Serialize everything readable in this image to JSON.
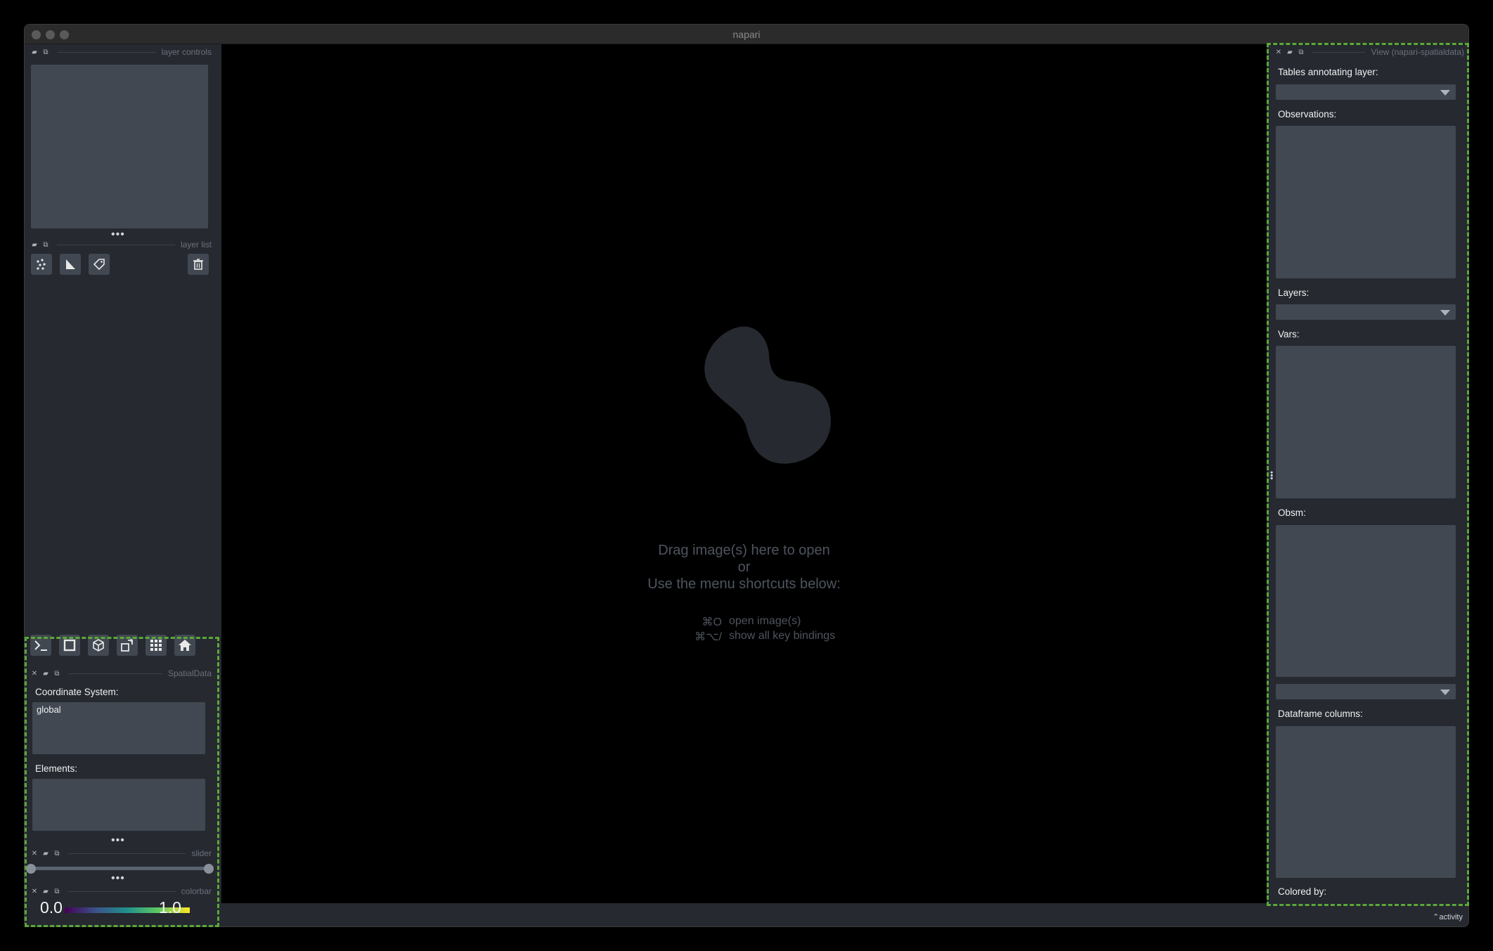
{
  "window": {
    "title": "napari"
  },
  "layer_controls": {
    "title": "layer controls",
    "more": "•••"
  },
  "layer_list": {
    "title": "layer list",
    "buttons": [
      {
        "name": "new-points-layer",
        "icon": "points-icon"
      },
      {
        "name": "new-shapes-layer",
        "icon": "shapes-icon"
      },
      {
        "name": "new-labels-layer",
        "icon": "labels-icon"
      },
      {
        "name": "delete-layer",
        "icon": "trash-icon"
      }
    ]
  },
  "viewer_buttons": [
    {
      "name": "console",
      "icon": "console-icon"
    },
    {
      "name": "ndisplay",
      "icon": "square-icon"
    },
    {
      "name": "roll",
      "icon": "cube-icon"
    },
    {
      "name": "transpose",
      "icon": "transpose-icon"
    },
    {
      "name": "grid",
      "icon": "grid-icon"
    },
    {
      "name": "home",
      "icon": "home-icon"
    }
  ],
  "spatialdata": {
    "title": "SpatialData",
    "coordinate_label": "Coordinate System:",
    "coordinate_items": [
      "global"
    ],
    "elements_label": "Elements:",
    "more": "•••"
  },
  "slider": {
    "title": "slider",
    "more": "•••"
  },
  "colorbar": {
    "title": "colorbar",
    "min": "0.0",
    "max": "1.0"
  },
  "canvas": {
    "line1": "Drag image(s) here to open",
    "line2": "or",
    "line3": "Use the menu shortcuts below:",
    "shortcuts": [
      {
        "keys": "⌘O",
        "desc": "open image(s)"
      },
      {
        "keys": "⌘⌥/",
        "desc": "show all key bindings"
      }
    ]
  },
  "right_panel": {
    "title": "View (napari-spatialdata)",
    "tables_label": "Tables annotating layer:",
    "observations_label": "Observations:",
    "layers_label": "Layers:",
    "vars_label": "Vars:",
    "obsm_label": "Obsm:",
    "dataframe_label": "Dataframe columns:",
    "colored_by_label": "Colored by:"
  },
  "status": {
    "activity": "activity"
  },
  "colors": {
    "accent_highlight": "#5aa83a",
    "panel": "#414851",
    "background": "#262930"
  }
}
